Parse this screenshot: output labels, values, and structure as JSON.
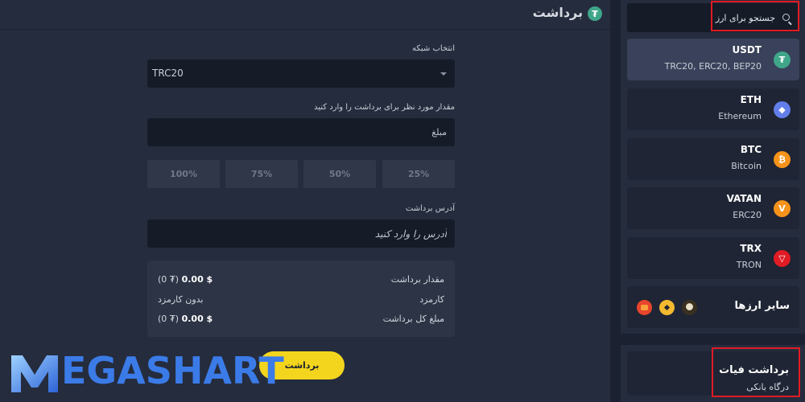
{
  "header": {
    "title": "برداشت"
  },
  "form": {
    "network_label": "انتخاب شبکه",
    "network_value": "TRC20",
    "amount_label": "مقدار مورد نظر برای برداشت را وارد کنید",
    "amount_placeholder": "مبلغ",
    "percents": [
      "100%",
      "75%",
      "50%",
      "25%"
    ],
    "address_label": "آدرس برداشت",
    "address_placeholder": "آدرس را وارد کنید",
    "summary": {
      "amount_label": "مقدار برداشت",
      "amount_value": "0.00 $",
      "amount_toman": "(0 ₮)",
      "fee_label": "کارمزد",
      "fee_value": "بدون کارمزد",
      "total_label": "مبلغ کل برداشت",
      "total_value": "0.00 $",
      "total_toman": "(0 ₮)"
    },
    "submit_label": "برداشت"
  },
  "brand": {
    "name": "EGASHART"
  },
  "sidebar": {
    "search_placeholder": "جستجو برای ارز",
    "coins": [
      {
        "symbol": "USDT",
        "sub": "TRC20, ERC20, BEP20",
        "icon": "tether-icon",
        "color": "#3fa68a",
        "glyph": "₮"
      },
      {
        "symbol": "ETH",
        "sub": "Ethereum",
        "icon": "ethereum-icon",
        "color": "#627eea",
        "glyph": "◆"
      },
      {
        "symbol": "BTC",
        "sub": "Bitcoin",
        "icon": "bitcoin-icon",
        "color": "#f7931a",
        "glyph": "₿"
      },
      {
        "symbol": "VATAN",
        "sub": "ERC20",
        "icon": "vatan-icon",
        "color": "#f7931a",
        "glyph": "V"
      },
      {
        "symbol": "TRX",
        "sub": "TRON",
        "icon": "tron-icon",
        "color": "#e01b24",
        "glyph": "▽"
      }
    ],
    "others_label": "سایر ارزها"
  },
  "fiat": {
    "title": "برداشت فیات",
    "subtitle": "درگاه بانکی"
  },
  "colors": {
    "accent": "#f4d51d",
    "highlight": "#e01b24",
    "brand": "#3b7be8"
  }
}
